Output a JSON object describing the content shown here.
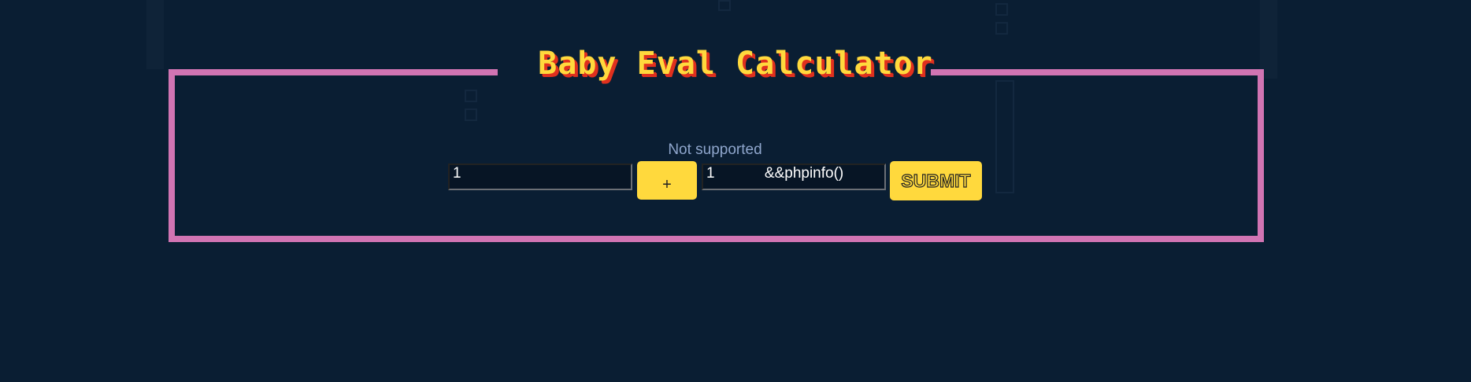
{
  "title": "Baby Eval Calculator",
  "message": "Not supported",
  "form": {
    "operand1_value": "1",
    "operator_label": "+",
    "operand2_value": "1            &&phpinfo()",
    "submit_label": "SUBMIT"
  },
  "colors": {
    "background": "#0a1e33",
    "frame": "#d174b3",
    "accent": "#ffd93d",
    "title_shadow": "#e0301e"
  }
}
